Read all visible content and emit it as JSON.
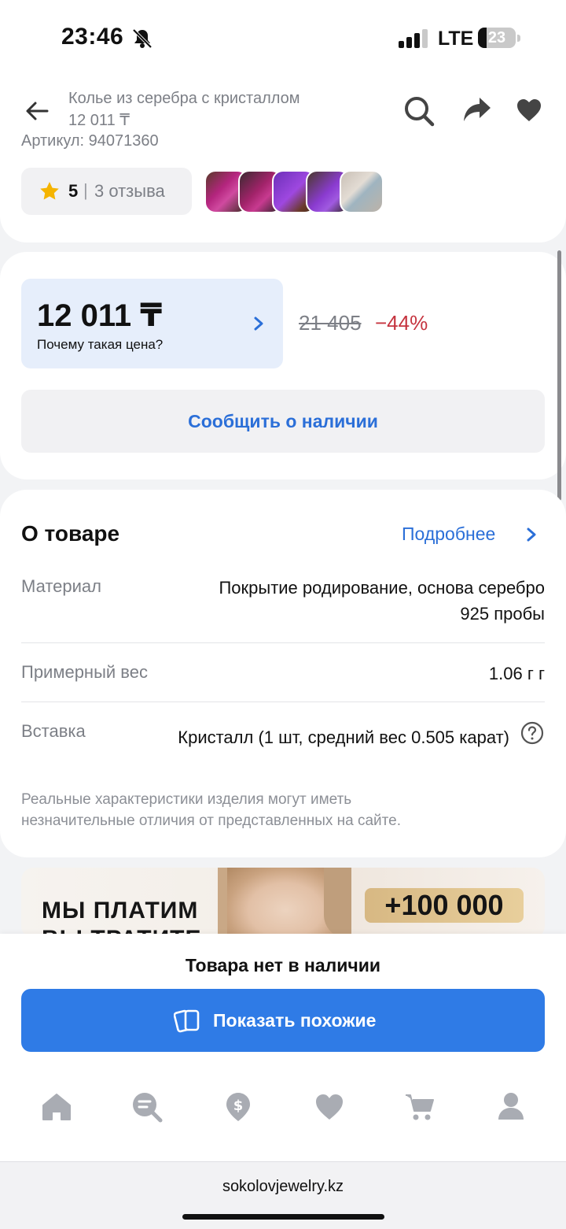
{
  "status": {
    "time": "23:46",
    "network": "LTE",
    "battery": "23",
    "battery_level": 0.23
  },
  "header": {
    "title": "Колье из серебра с кристаллом",
    "price": "12 011 ₸",
    "article": "Артикул: 94071360",
    "icons": {
      "back": "arrow-left",
      "search": "search",
      "share": "share",
      "favorite": "heart"
    }
  },
  "rating": {
    "value": "5",
    "separator": "|",
    "reviews": "3 отзыва"
  },
  "price": {
    "current": "12 011 ₸",
    "why": "Почему такая цена?",
    "old": "21 405",
    "discount": "−44%",
    "notify_button": "Сообщить о наличии"
  },
  "about": {
    "title": "О товаре",
    "more": "Подробнее",
    "specs": [
      {
        "label": "Материал",
        "value_line1": "Покрытие родирование, основа серебро",
        "value_line2": "925 пробы"
      },
      {
        "label": "Примерный вес",
        "value": "1.06 г г"
      },
      {
        "label": "Вставка",
        "value": "Кристалл (1 шт, средний вес 0.505 карат)"
      }
    ],
    "disclaimer": "Реальные характеристики изделия могут иметь незначительные отличия от представленных на сайте."
  },
  "banner": {
    "line1": "МЫ ПЛАТИМ",
    "line2": "ВЫ ТРАТИТЕ",
    "bonus": "+100 000"
  },
  "bottom": {
    "out_of_stock": "Товара нет в наличии",
    "show_similar": "Показать похожие",
    "nav": [
      "home",
      "catalog-search",
      "bonus",
      "favorites",
      "cart",
      "profile"
    ]
  },
  "browser": {
    "url": "sokolovjewelry.kz"
  },
  "colors": {
    "accent": "#2f7be6",
    "link": "#2b6fd8",
    "discount": "#c5343f",
    "star": "#f5b400"
  }
}
